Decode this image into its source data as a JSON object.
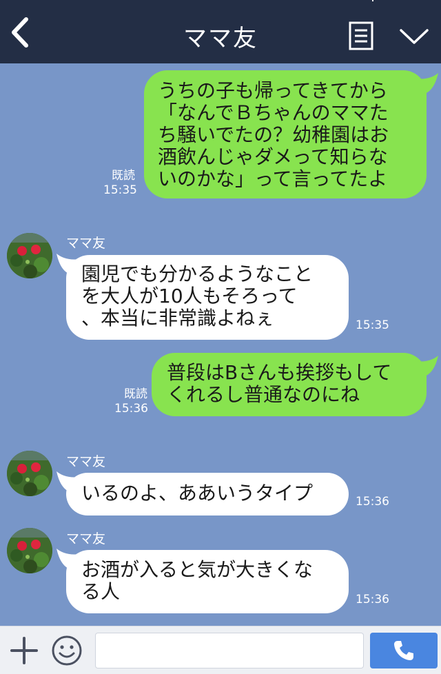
{
  "header": {
    "title": "ママ友",
    "icons": {
      "back": "chevron-left-icon",
      "menu": "note-icon",
      "collapse": "chevron-down-icon"
    }
  },
  "messages": [
    {
      "direction": "outgoing",
      "text": "うちの子も帰ってきてから\n「なんでＢちゃんのママた\nち騒いでたの？幼稚園はお\n酒飲んじゃダメって知らな\nいのかな」って言ってたよ",
      "read": "既読",
      "time": "15:35"
    },
    {
      "direction": "incoming",
      "sender": "ママ友",
      "text": "園児でも分かるようなこと\nを大人が10人もそろって\n、本当に非常識よねぇ",
      "time": "15:35"
    },
    {
      "direction": "outgoing",
      "text": "普段はBさんも挨拶もして\nくれるし普通なのにね",
      "read": "既読",
      "time": "15:36"
    },
    {
      "direction": "incoming",
      "sender": "ママ友",
      "text": "いるのよ、ああいうタイプ",
      "time": "15:36"
    },
    {
      "direction": "incoming",
      "sender": "ママ友",
      "text": "お酒が入ると気が大きくな\nる人",
      "time": "15:36"
    }
  ],
  "footer": {
    "input_value": "",
    "icons": {
      "plus": "plus-icon",
      "sticker": "smiley-icon",
      "call": "phone-icon"
    }
  },
  "colors": {
    "header_bg": "#232e45",
    "chat_bg": "#7896c8",
    "outgoing_bubble": "#88e34f",
    "incoming_bubble": "#ffffff",
    "call_button": "#4a86e0"
  }
}
